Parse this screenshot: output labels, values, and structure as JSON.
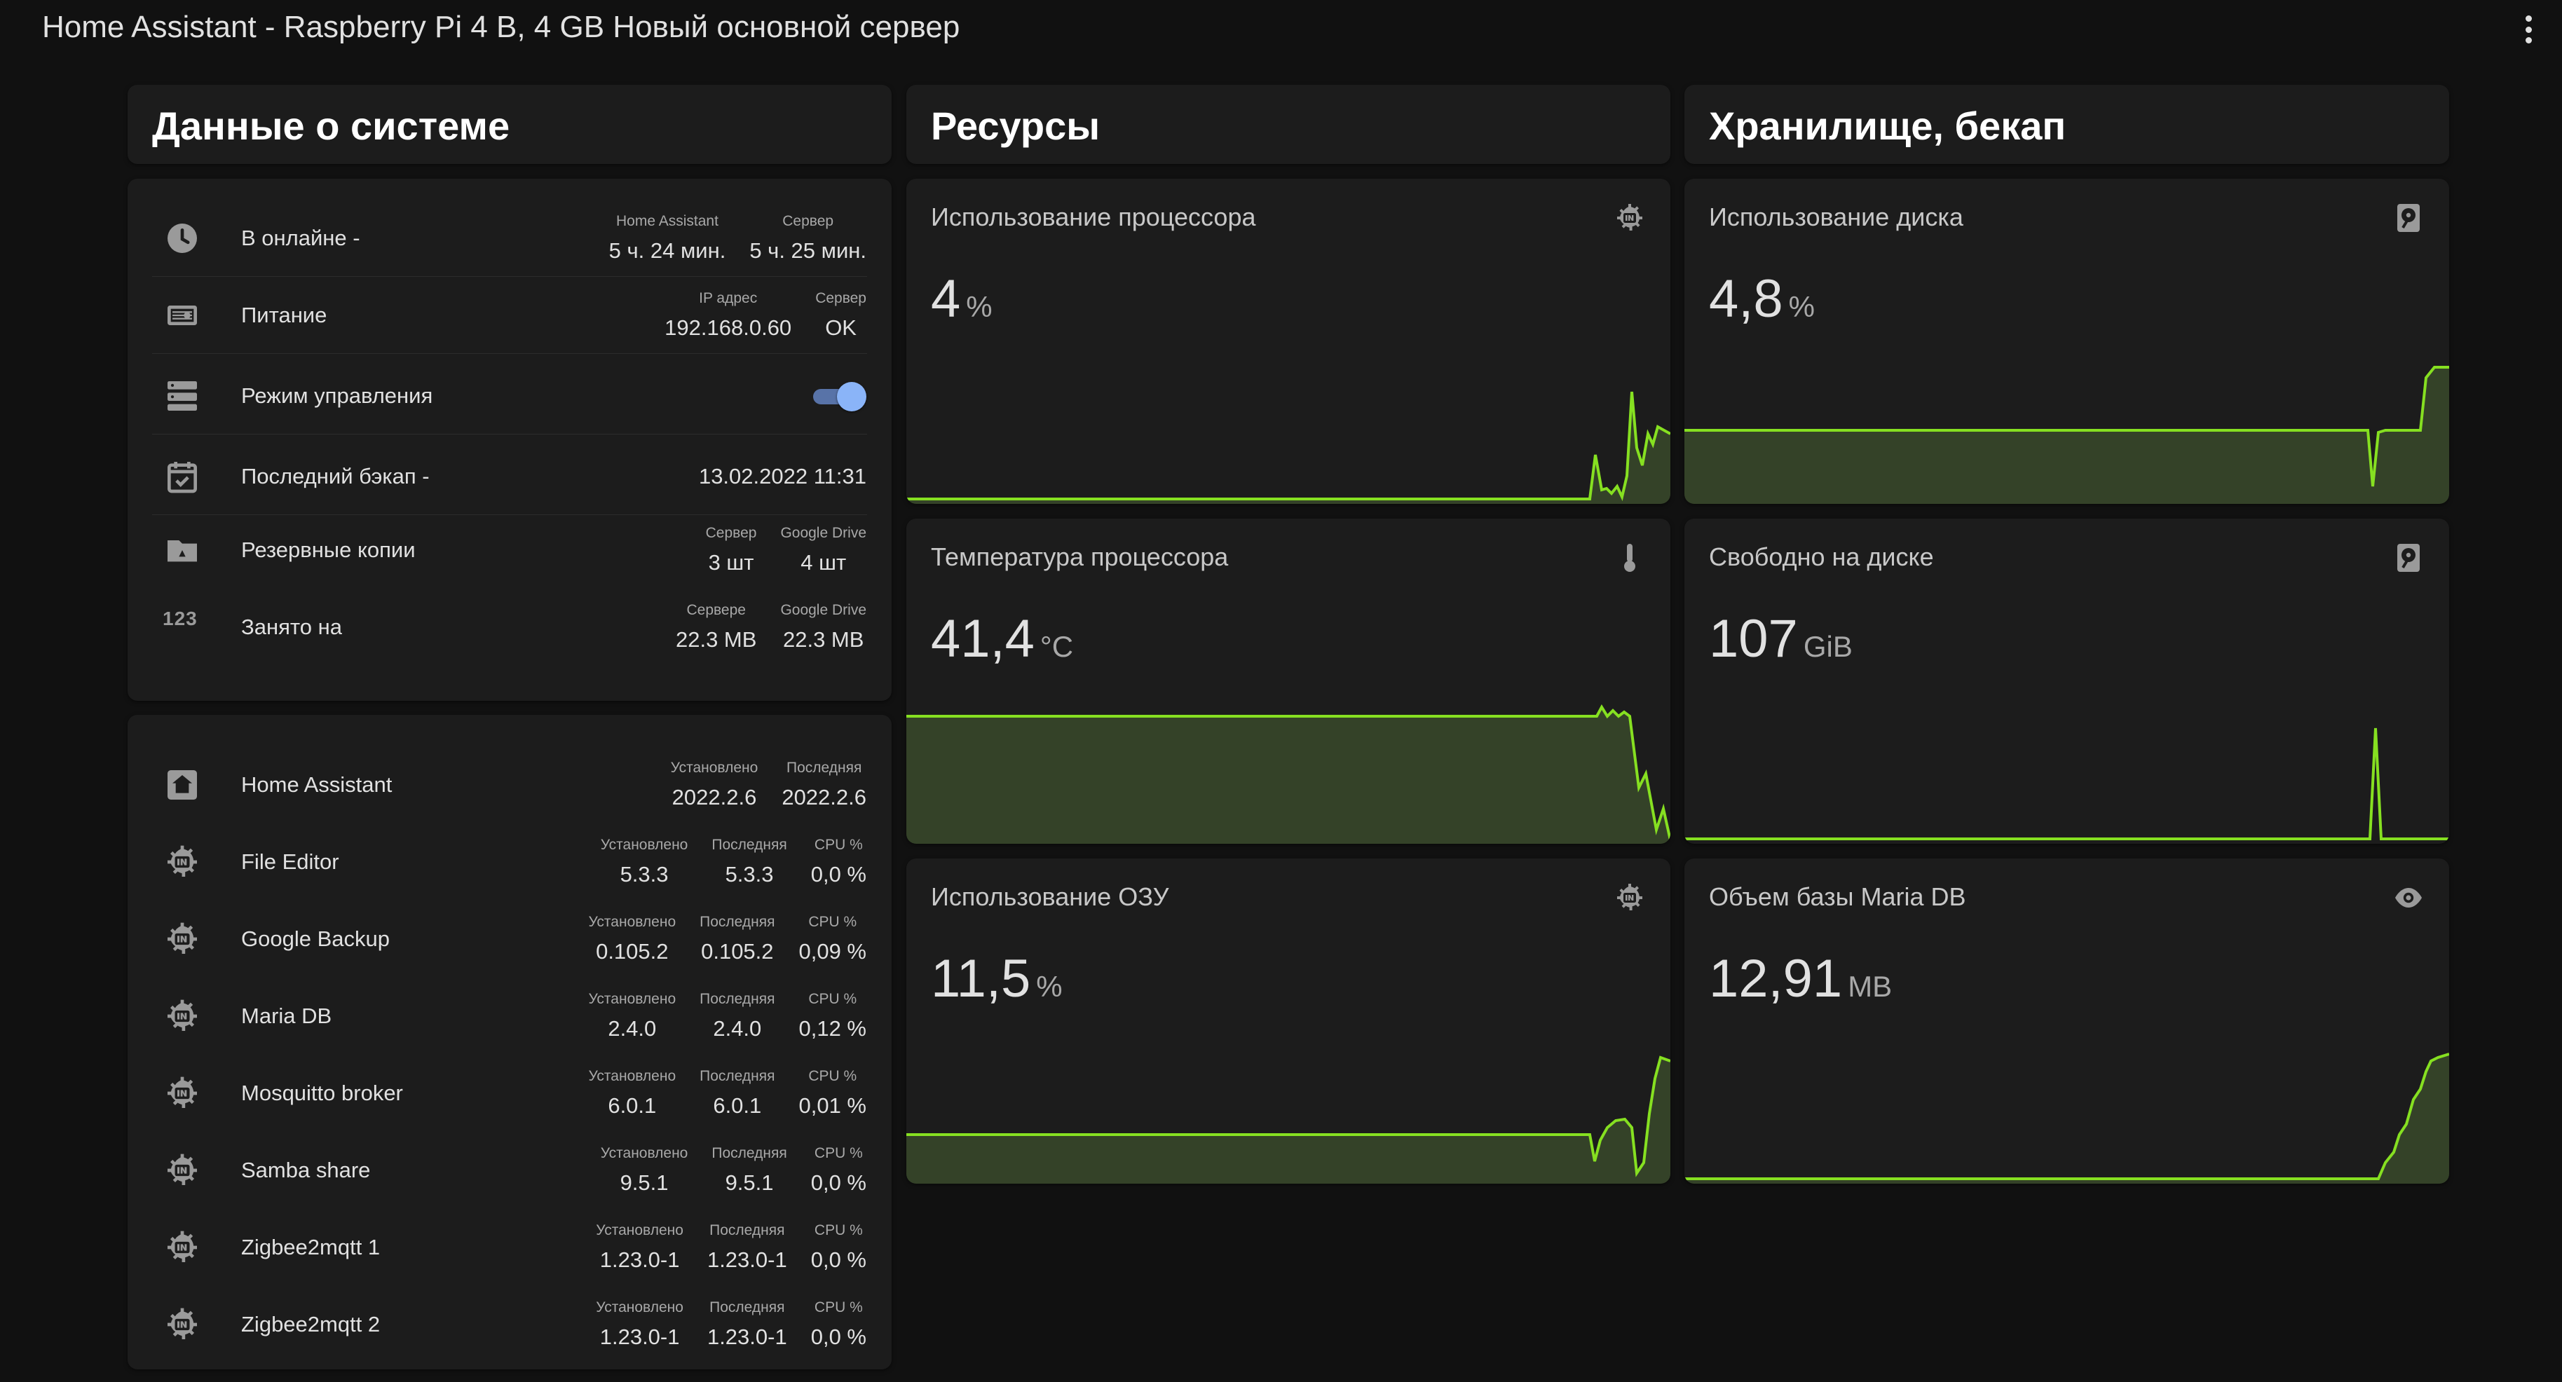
{
  "header": {
    "title": "Home Assistant - Raspberry Pi 4 B, 4 GB Новый основной сервер"
  },
  "colors": {
    "accent_graph": "#86e021",
    "graph_fill": "#344228",
    "toggle_on": "#8ab4f8"
  },
  "columns": {
    "system_title": "Данные о системе",
    "resources_title": "Ресурсы",
    "storage_title": "Хранилище, бекап"
  },
  "system": {
    "online": {
      "label": "В онлайне -",
      "icon": "clock-icon",
      "cols": [
        {
          "h": "Home Assistant",
          "v": "5 ч. 24 мин."
        },
        {
          "h": "Сервер",
          "v": "5 ч. 25 мин."
        }
      ]
    },
    "power": {
      "label": "Питание",
      "icon": "power-supply-icon",
      "cols": [
        {
          "h": "IP адрес",
          "v": "192.168.0.60"
        },
        {
          "h": "Сервер",
          "v": "OK"
        }
      ]
    },
    "control": {
      "label": "Режим управления",
      "icon": "server-icon",
      "toggle_on": true
    },
    "backup": {
      "label": "Последний бэкап -",
      "icon": "calendar-check-icon",
      "value": "13.02.2022 11:31"
    },
    "copies": {
      "label": "Резервные копии",
      "icon": "folder-drive-icon",
      "cols": [
        {
          "h": "Сервер",
          "v": "3 шт"
        },
        {
          "h": "Google Drive",
          "v": "4 шт"
        }
      ]
    },
    "used": {
      "label": "Занято на",
      "icon": "numeric-icon",
      "icon_text": "123",
      "cols": [
        {
          "h": "Сервере",
          "v": "22.3 MB"
        },
        {
          "h": "Google Drive",
          "v": "22.3 MB"
        }
      ]
    }
  },
  "addons": [
    {
      "name": "Home Assistant",
      "icon": "home-assistant-icon",
      "cols": [
        {
          "h": "Установлено",
          "v": "2022.2.6"
        },
        {
          "h": "Последняя",
          "v": "2022.2.6"
        }
      ]
    },
    {
      "name": "File Editor",
      "icon": "addon-chip-icon",
      "cols": [
        {
          "h": "Установлено",
          "v": "5.3.3"
        },
        {
          "h": "Последняя",
          "v": "5.3.3"
        },
        {
          "h": "CPU %",
          "v": "0,0 %"
        }
      ]
    },
    {
      "name": "Google Backup",
      "icon": "addon-chip-icon",
      "cols": [
        {
          "h": "Установлено",
          "v": "0.105.2"
        },
        {
          "h": "Последняя",
          "v": "0.105.2"
        },
        {
          "h": "CPU %",
          "v": "0,09 %"
        }
      ]
    },
    {
      "name": "Maria DB",
      "icon": "addon-chip-icon",
      "cols": [
        {
          "h": "Установлено",
          "v": "2.4.0"
        },
        {
          "h": "Последняя",
          "v": "2.4.0"
        },
        {
          "h": "CPU %",
          "v": "0,12 %"
        }
      ]
    },
    {
      "name": "Mosquitto broker",
      "icon": "addon-chip-icon",
      "cols": [
        {
          "h": "Установлено",
          "v": "6.0.1"
        },
        {
          "h": "Последняя",
          "v": "6.0.1"
        },
        {
          "h": "CPU %",
          "v": "0,01 %"
        }
      ]
    },
    {
      "name": "Samba share",
      "icon": "addon-chip-icon",
      "cols": [
        {
          "h": "Установлено",
          "v": "9.5.1"
        },
        {
          "h": "Последняя",
          "v": "9.5.1"
        },
        {
          "h": "CPU %",
          "v": "0,0 %"
        }
      ]
    },
    {
      "name": "Zigbee2mqtt 1",
      "icon": "addon-chip-icon",
      "cols": [
        {
          "h": "Установлено",
          "v": "1.23.0-1"
        },
        {
          "h": "Последняя",
          "v": "1.23.0-1"
        },
        {
          "h": "CPU %",
          "v": "0,0 %"
        }
      ]
    },
    {
      "name": "Zigbee2mqtt 2",
      "icon": "addon-chip-icon",
      "cols": [
        {
          "h": "Установлено",
          "v": "1.23.0-1"
        },
        {
          "h": "Последняя",
          "v": "1.23.0-1"
        },
        {
          "h": "CPU %",
          "v": "0,0 %"
        }
      ]
    }
  ],
  "resources": {
    "cpu": {
      "name": "Использование процессора",
      "value": "4",
      "unit": "%",
      "icon": "cpu-chip-icon"
    },
    "temp": {
      "name": "Температура процессора",
      "value": "41,4",
      "unit": "°C",
      "icon": "thermometer-icon"
    },
    "ram": {
      "name": "Использование ОЗУ",
      "value": "11,5",
      "unit": "%",
      "icon": "memory-icon"
    }
  },
  "storage": {
    "disk": {
      "name": "Использование диска",
      "value": "4,8",
      "unit": "%",
      "icon": "harddisk-icon"
    },
    "free": {
      "name": "Свободно на диске",
      "value": "107",
      "unit": "GiB",
      "icon": "harddisk-icon"
    },
    "db": {
      "name": "Объем базы Maria DB",
      "value": "12,91",
      "unit": "MB",
      "icon": "eye-icon"
    }
  }
}
